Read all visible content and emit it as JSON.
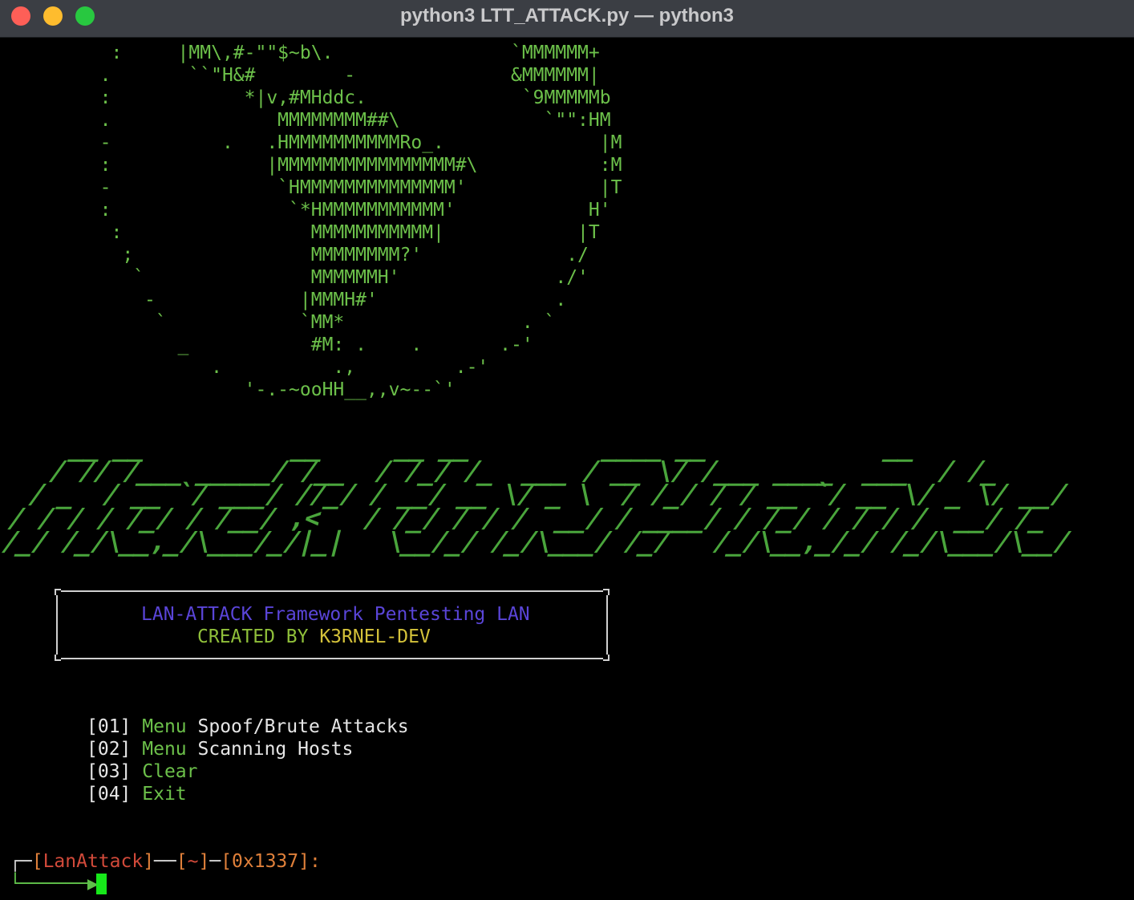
{
  "window": {
    "title": "python3 LTT_ATTACK.py — python3",
    "controls": [
      "close",
      "minimize",
      "zoom"
    ]
  },
  "terminal": {
    "logo_lines": [
      "          :     |MM\\,#-\"\"$~b\\.                `MMMMMM+",
      "         .       ``\"H&#        -              &MMMMMM|",
      "         :            *|v,#MHddc.              `9MMMMMb",
      "         .               MMMMMMMM##\\             `\"\":HM",
      "         -          .   .HMMMMMMMMMMRo_.              |M",
      "         :              |MMMMMMMMMMMMMMMM#\\           :M",
      "         -               `HMMMMMMMMMMMMMM'            |T",
      "         :                `*HMMMMMMMMMMM'            H'",
      "          :                 MMMMMMMMMMM|            |T",
      "           ;                MMMMMMMM?'             ./",
      "            `               MMMMMMH'              ./'",
      "             -             |MMMH#'                .",
      "              `            `MM*                . `",
      "                _           #M: .    .       .-'",
      "                   .          .,         .-'",
      "                      '-.-~ooHH__,,v~--`'"
    ],
    "banner_lines": [
      "   __ __          __     __ __         ____ __            __",
      "  / // /___ _____/ /__  / /_/ /_  ___ / __ \\/ /___ ____  ___  / /_",
      " / _  / __ `/ ___/ //_/ / __/ __ \\/ _ \\  / /_/ / / __ `/ __ \\/ _ \\/ __/",
      "/ / / / /_/ / /__/ ,<   / /_/ / / /  __/ / ____/ / /_/ / / / /  __/ /_",
      "/_/ /_/\\__,_/\\___/_/|_|   \\__/_/ /_/\\___/ /_/   /_/\\__,_/_/ /_/\\___/\\__/"
    ],
    "box": {
      "line1": "LAN-ATTACK Framework Pentesting LAN",
      "line2_a": "CREATED BY ",
      "line2_b": "K3RNEL-DEV"
    },
    "menu": [
      {
        "num": "[01]",
        "verb": "Menu",
        "text": "Spoof/Brute Attacks"
      },
      {
        "num": "[02]",
        "verb": "Menu",
        "text": "Scanning Hosts"
      },
      {
        "num": "[03]",
        "verb": "Clear",
        "text": ""
      },
      {
        "num": "[04]",
        "verb": "Exit",
        "text": ""
      }
    ],
    "prompt": {
      "corner_top": "┌─",
      "name": "LanAttack",
      "path": "~",
      "code": "0x1337",
      "corner_bottom": "└──────▶"
    }
  },
  "colors": {
    "logo": "#6cc04a",
    "banner": "#4aa53c",
    "box_title": "#5a45d8",
    "created_by": "#8fbf3a",
    "author": "#d4c23a",
    "prompt_name": "#d24a3a",
    "cursor": "#17e81a"
  }
}
